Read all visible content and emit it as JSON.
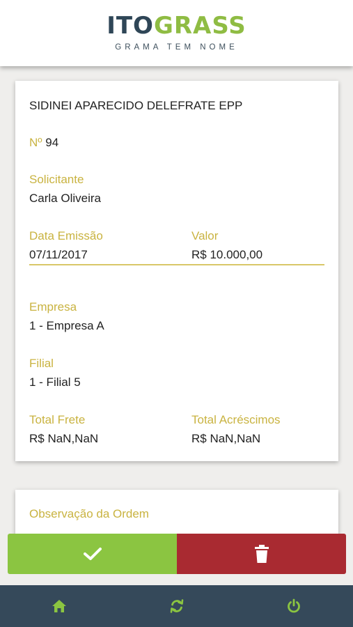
{
  "brand": {
    "name_part_a": "ITO",
    "name_part_b": "GRASS",
    "tagline": "GRAMA TEM NOME"
  },
  "order": {
    "company_name": "SIDINEI APARECIDO DELEFRATE EPP",
    "number_label": "Nº",
    "number_value": "94",
    "requester_label": "Solicitante",
    "requester_value": "Carla Oliveira",
    "issue_date_label": "Data Emissão",
    "issue_date_value": "07/11/2017",
    "amount_label": "Valor",
    "amount_value": "R$ 10.000,00",
    "empresa_label": "Empresa",
    "empresa_value": "1 - Empresa A",
    "filial_label": "Filial",
    "filial_value": "1 - Filial 5",
    "freight_label": "Total Frete",
    "freight_value": "R$ NaN,NaN",
    "surcharges_label": "Total Acréscimos",
    "surcharges_value": "R$ NaN,NaN"
  },
  "observation": {
    "label": "Observação da Ordem"
  },
  "actions": {
    "approve_icon": "check-icon",
    "delete_icon": "trash-icon"
  },
  "navbar": {
    "items": [
      {
        "icon": "home-icon"
      },
      {
        "icon": "refresh-icon"
      },
      {
        "icon": "power-icon"
      }
    ]
  },
  "colors": {
    "label_gold": "#c9b340",
    "approve_green": "#8bc541",
    "delete_red": "#a92a31",
    "navbar_navy": "#35495a",
    "icon_green": "#8bc541"
  }
}
